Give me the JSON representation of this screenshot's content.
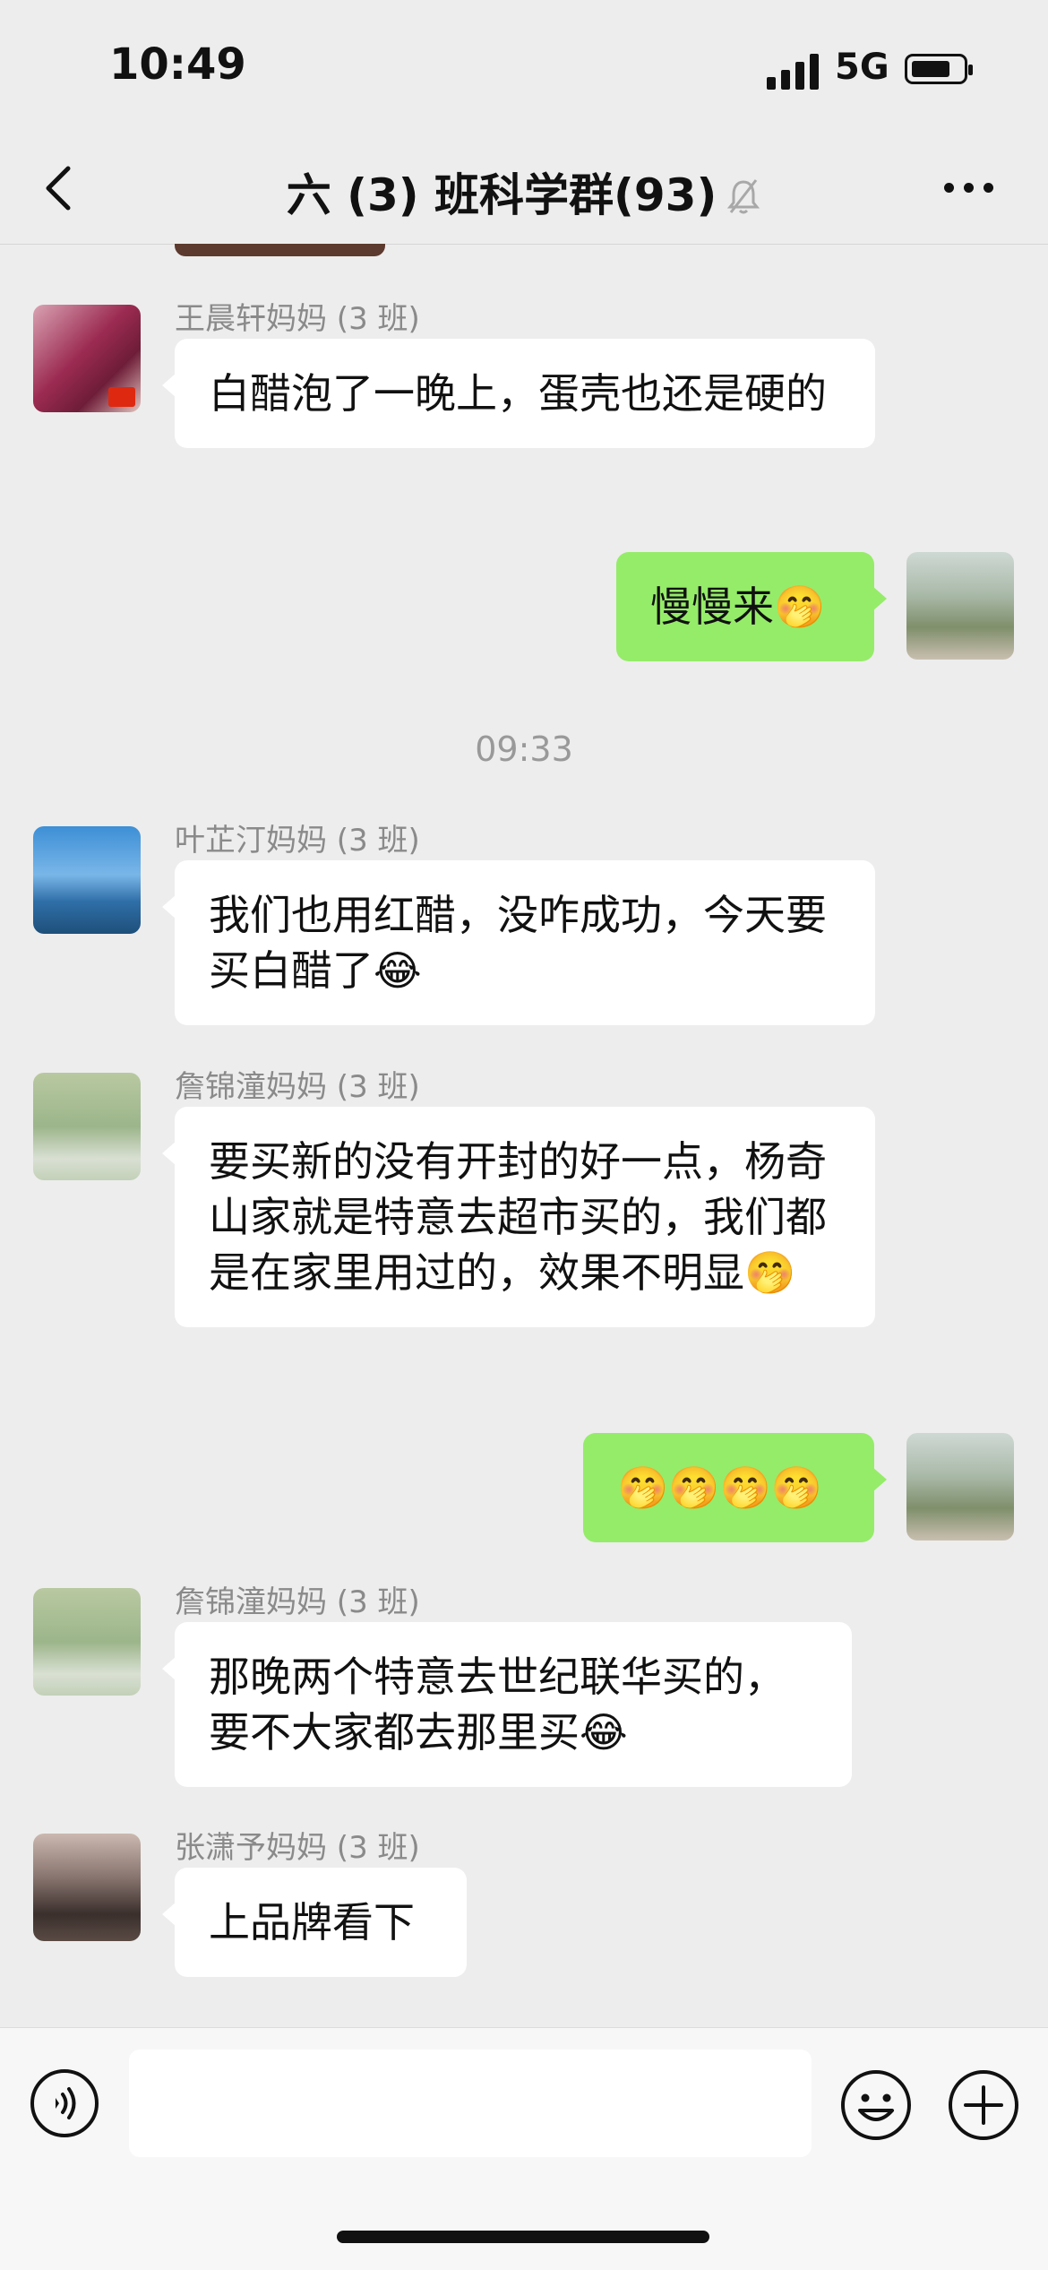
{
  "status_bar": {
    "time": "10:49",
    "network": "5G"
  },
  "header": {
    "title": "六 (3) 班科学群(93)"
  },
  "messages": [
    {
      "sender": "王晨轩妈妈 (3 班)",
      "text": "白醋泡了一晚上，蛋壳也还是硬的"
    },
    {
      "text": "慢慢来🤭"
    },
    {
      "timestamp": "09:33"
    },
    {
      "sender": "叶芷汀妈妈 (3 班)",
      "text": "我们也用红醋，没咋成功，今天要买白醋了😂"
    },
    {
      "sender": "詹锦潼妈妈 (3 班)",
      "text": "要买新的没有开封的好一点，杨奇山家就是特意去超市买的，我们都是在家里用过的，效果不明显🤭"
    },
    {
      "text": "🤭🤭🤭🤭"
    },
    {
      "sender": "詹锦潼妈妈 (3 班)",
      "text": "那晚两个特意去世纪联华买的，要不大家都去那里买😂"
    },
    {
      "sender": "张潇予妈妈 (3 班)",
      "text": "上品牌看下"
    }
  ],
  "input_bar": {
    "placeholder": ""
  }
}
